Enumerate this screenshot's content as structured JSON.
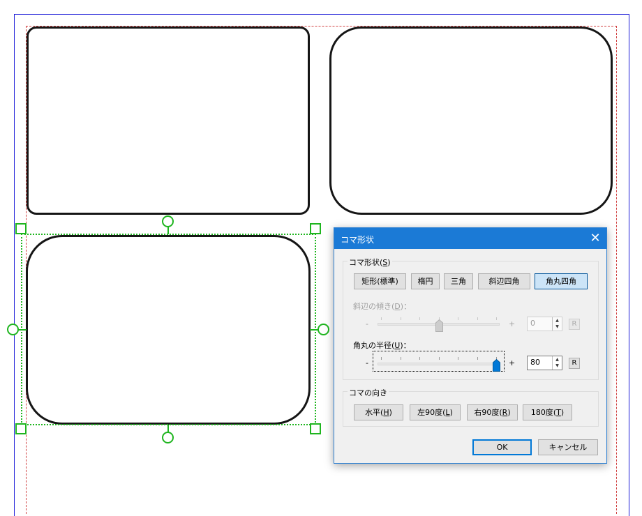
{
  "dialog": {
    "title": "コマ形状",
    "shape_group": {
      "label_prefix": "コマ形状(",
      "label_key": "S",
      "label_suffix": ")",
      "buttons": [
        {
          "label": "矩形(標準)",
          "active": false
        },
        {
          "label": "楕円",
          "active": false
        },
        {
          "label": "三角",
          "active": false
        },
        {
          "label": "斜辺四角",
          "active": false
        },
        {
          "label": "角丸四角",
          "active": true
        }
      ],
      "slant": {
        "label_prefix": "斜辺の傾き(",
        "label_key": "D",
        "label_suffix": ")：",
        "minus": "-",
        "plus": "+",
        "value": "0",
        "reset": "R",
        "enabled": false,
        "level": 0.5
      },
      "radius": {
        "label_prefix": "角丸の半径(",
        "label_key": "U",
        "label_suffix": ")：",
        "minus": "-",
        "plus": "+",
        "value": "80",
        "reset": "R",
        "enabled": true,
        "level": 1.0
      }
    },
    "orientation_group": {
      "label": "コマの向き",
      "buttons": [
        {
          "prefix": "水平(",
          "key": "H",
          "suffix": ")"
        },
        {
          "prefix": "左90度(",
          "key": "L",
          "suffix": ")"
        },
        {
          "prefix": "右90度(",
          "key": "R",
          "suffix": ")"
        },
        {
          "prefix": "180度(",
          "key": "T",
          "suffix": ")"
        }
      ]
    },
    "ok_label": "OK",
    "cancel_label": "キャンセル"
  },
  "colors": {
    "selection": "#1fb51f",
    "page_border": "#1a1ad8",
    "margin_guide": "#d04040",
    "titlebar": "#1b7ad6",
    "slider_thumb": "#0078d7"
  }
}
